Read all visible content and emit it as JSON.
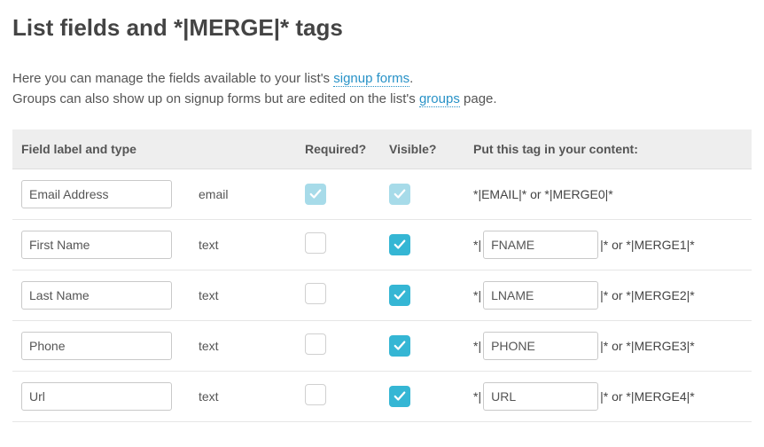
{
  "page": {
    "title": "List fields and *|MERGE|* tags",
    "intro_pre": "Here you can manage the fields available to your list's ",
    "link_signup": "signup forms",
    "intro_post": ".",
    "intro2_pre": "Groups can also show up on signup forms but are edited on the list's ",
    "link_groups": "groups",
    "intro2_post": " page."
  },
  "table": {
    "headers": {
      "label": "Field label and type",
      "required": "Required?",
      "visible": "Visible?",
      "tag": "Put this tag in your content:"
    },
    "rows": [
      {
        "label": "Email Address",
        "type": "email",
        "required": "locked",
        "visible": "locked",
        "tag_static": "*|EMAIL|* or *|MERGE0|*"
      },
      {
        "label": "First Name",
        "type": "text",
        "required": "off",
        "visible": "on",
        "tag_value": "FNAME",
        "merge_suffix": " |* or *|MERGE1|*"
      },
      {
        "label": "Last Name",
        "type": "text",
        "required": "off",
        "visible": "on",
        "tag_value": "LNAME",
        "merge_suffix": " |* or *|MERGE2|*"
      },
      {
        "label": "Phone",
        "type": "text",
        "required": "off",
        "visible": "on",
        "tag_value": "PHONE",
        "merge_suffix": " |* or *|MERGE3|*"
      },
      {
        "label": "Url",
        "type": "text",
        "required": "off",
        "visible": "on",
        "tag_value": "URL",
        "merge_suffix": " |* or *|MERGE4|*"
      }
    ],
    "tag_prefix": "*| "
  }
}
